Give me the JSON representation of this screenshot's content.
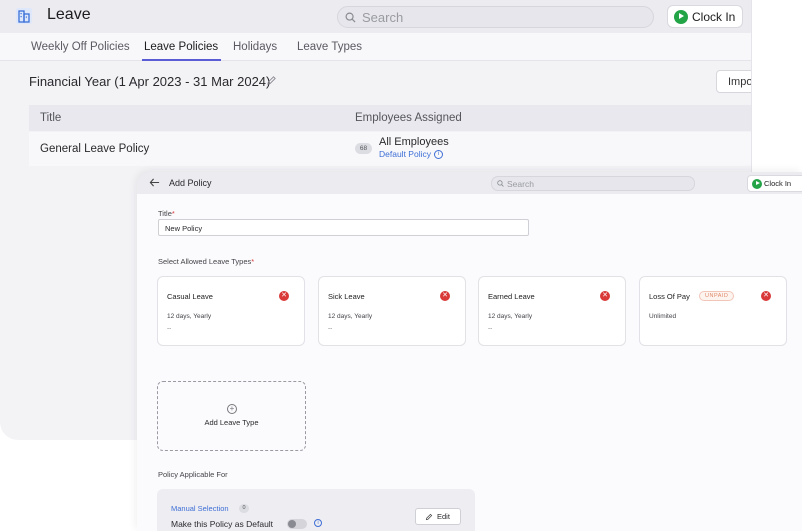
{
  "back_window": {
    "app_title": "Leave",
    "search_placeholder": "Search",
    "clock_in_label": "Clock In",
    "tabs": [
      {
        "label": "Weekly Off Policies"
      },
      {
        "label": "Leave Policies",
        "active": true
      },
      {
        "label": "Holidays"
      },
      {
        "label": "Leave Types"
      }
    ],
    "financial_year": "Financial Year (1 Apr 2023 - 31 Mar 2024)",
    "import_label": "Impor",
    "table": {
      "headers": [
        "Title",
        "Employees Assigned"
      ],
      "rows": [
        {
          "title": "General Leave Policy",
          "count": "68",
          "employees": "All Employees",
          "default_label": "Default Policy"
        }
      ]
    }
  },
  "front_window": {
    "title": "Add Policy",
    "search_placeholder": "Search",
    "clock_in_label": "Clock In",
    "form": {
      "title_label": "Title",
      "title_value": "New Policy",
      "leave_types_label": "Select Allowed Leave Types",
      "leave_types": [
        {
          "name": "Casual Leave",
          "frequency": "12 days, Yearly",
          "extra": "--"
        },
        {
          "name": "Sick Leave",
          "frequency": "12 days, Yearly",
          "extra": "--"
        },
        {
          "name": "Earned Leave",
          "frequency": "12 days, Yearly",
          "extra": "--"
        },
        {
          "name": "Loss Of Pay",
          "badge": "UNPAID",
          "frequency": "Unlimited",
          "extra": ""
        }
      ],
      "add_leave_type_label": "Add Leave Type",
      "applicable_label": "Policy Applicable For",
      "manual_selection_label": "Manual Selection",
      "manual_selection_count": "0",
      "default_toggle_label": "Make this Policy as Default",
      "edit_label": "Edit"
    }
  },
  "colors": {
    "accent": "#5a5cd6",
    "link": "#3f6fd6",
    "clock_in_green": "#22a447",
    "remove_red": "#d93939",
    "unpaid_text": "#e08a6a"
  }
}
